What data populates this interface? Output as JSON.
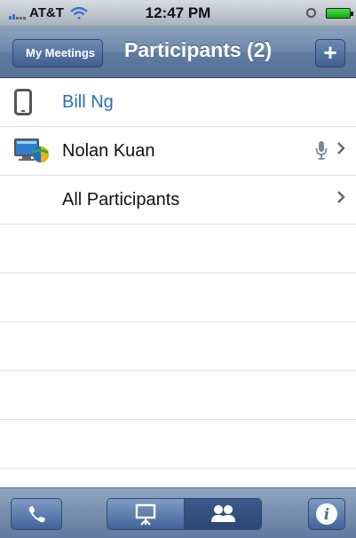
{
  "status_bar": {
    "carrier": "AT&T",
    "time": "12:47 PM"
  },
  "nav": {
    "back_label": "My Meetings",
    "title": "Participants (2)",
    "add_label": "+"
  },
  "participants": [
    {
      "name": "Bill Ng",
      "icon": "mobile-phone-icon",
      "color": "#2a6fb8"
    },
    {
      "name": "Nolan Kuan",
      "icon": "computer-globe-icon",
      "color": "#111111"
    },
    {
      "name": "All Participants",
      "icon": "",
      "color": "#111111"
    }
  ],
  "tab_bar": {
    "items": [
      "phone-icon",
      "presentation-icon",
      "participants-icon",
      "info-icon"
    ],
    "active": "participants-icon"
  }
}
